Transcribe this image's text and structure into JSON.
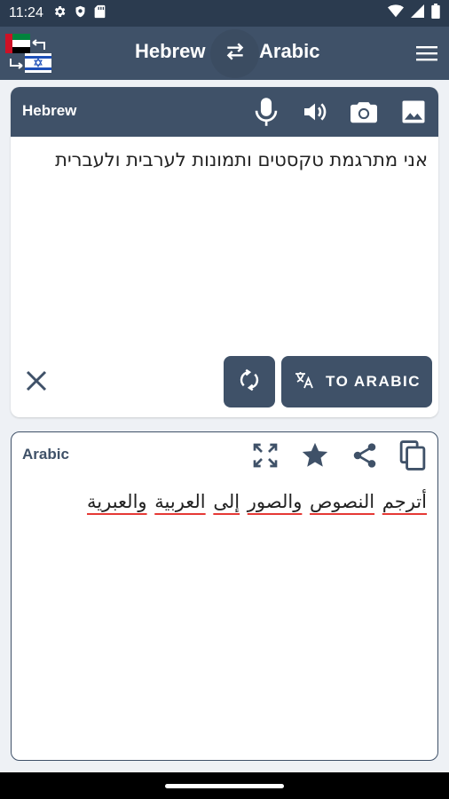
{
  "status_bar": {
    "time": "11:24",
    "left_icons": [
      "settings-icon",
      "shield-icon",
      "sd-card-icon"
    ],
    "right_icons": [
      "wifi-icon",
      "signal-icon",
      "battery-icon"
    ]
  },
  "app_bar": {
    "source_language": "Hebrew",
    "target_language": "Arabic",
    "flags": [
      "uae-flag",
      "israel-flag"
    ],
    "swap_icon": "swap-arrows-icon",
    "menu_icon": "hamburger-menu-icon"
  },
  "input_panel": {
    "language_label": "Hebrew",
    "icons": [
      "microphone-icon",
      "speaker-icon",
      "camera-icon",
      "image-icon"
    ],
    "text": "אני מתרגמת טקסטים ותמונות לערבית ולעברית",
    "translate_button_label": "TO ARABIC"
  },
  "output_panel": {
    "language_label": "Arabic",
    "icons": [
      "fullscreen-icon",
      "star-icon",
      "share-icon",
      "copy-icon"
    ],
    "words": [
      "أترجم",
      "النصوص",
      "والصور",
      "إلى",
      "العربية",
      "والعبرية"
    ]
  },
  "colors": {
    "primary": "#3f5168",
    "status_bar": "#2b3b4f",
    "background": "#eef1f5",
    "spellcheck_underline": "#e53935"
  }
}
